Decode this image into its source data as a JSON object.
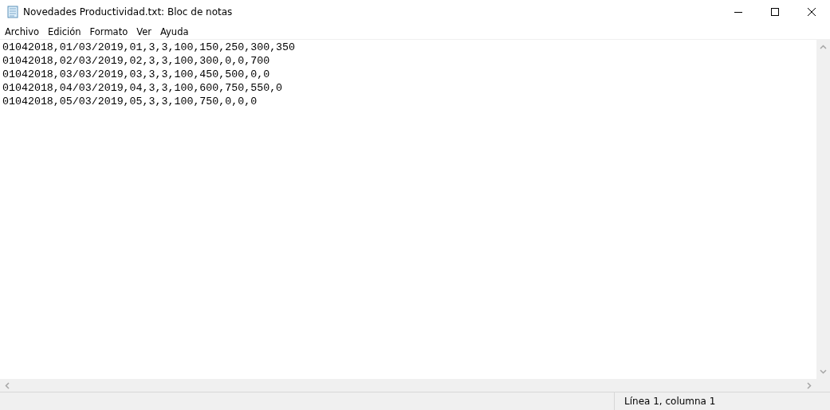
{
  "window": {
    "title": "Novedades Productividad.txt: Bloc de notas"
  },
  "menu": [
    "Archivo",
    "Edición",
    "Formato",
    "Ver",
    "Ayuda"
  ],
  "editor": {
    "lines": [
      "01042018,01/03/2019,01,3,3,100,150,250,300,350",
      "01042018,02/03/2019,02,3,3,100,300,0,0,700",
      "01042018,03/03/2019,03,3,3,100,450,500,0,0",
      "01042018,04/03/2019,04,3,3,100,600,750,550,0",
      "01042018,05/03/2019,05,3,3,100,750,0,0,0"
    ]
  },
  "status_bar": {
    "position": "Línea 1, columna 1"
  }
}
